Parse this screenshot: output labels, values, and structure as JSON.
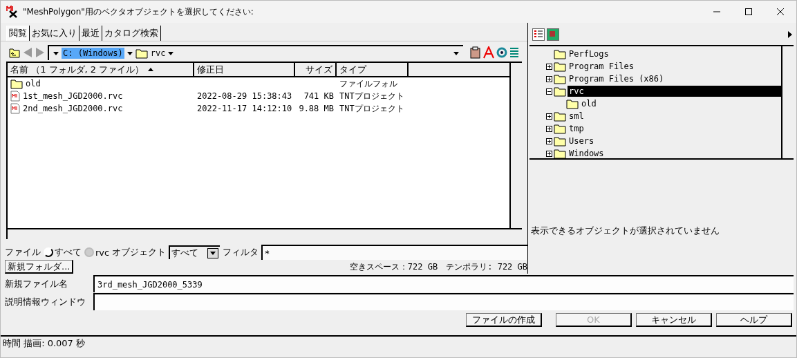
{
  "window": {
    "title": "\"MeshPolygon\"用のベクタオブジェクトを選択してください:"
  },
  "tabs": [
    {
      "label": "閲覧",
      "selected": true
    },
    {
      "label": "お気に入り",
      "selected": false
    },
    {
      "label": "最近",
      "selected": false
    },
    {
      "label": "カタログ検索",
      "selected": false
    }
  ],
  "path_bar": {
    "drive": "C: (Windows)",
    "folder": "rvc"
  },
  "file_list": {
    "columns": [
      "名前 （1 フォルダ, 2 ファイル）",
      "修正日",
      "サイズ",
      "タイプ"
    ],
    "rows": [
      {
        "kind": "folder",
        "name": "old",
        "modified": "",
        "size": "",
        "type": "ファイルフォル"
      },
      {
        "kind": "file",
        "name": "1st_mesh_JGD2000.rvc",
        "modified": "2022-08-29 15:38:43",
        "size": "741 KB",
        "type": "TNTプロジェクト"
      },
      {
        "kind": "file",
        "name": "2nd_mesh_JGD2000.rvc",
        "modified": "2022-11-17 14:12:10",
        "size": "9.88 MB",
        "type": "TNTプロジェクト"
      }
    ]
  },
  "filter_row": {
    "label": "ファイル",
    "radios": [
      {
        "label": "すべて",
        "selected": true
      },
      {
        "label": "rvc",
        "selected": false
      }
    ],
    "object_label": "オブジェクト",
    "object_value": "すべて",
    "filter_label": "フィルタ",
    "filter_value": "*"
  },
  "new_folder_button": "新規フォルダ...",
  "free_space": "空きスペース：722 GB",
  "temporary": "テンポラリ: 722 GB",
  "tree": [
    {
      "kind": "leaf",
      "name": "PerfLogs",
      "selected": false
    },
    {
      "kind": "branch",
      "name": "Program Files",
      "expanded": false,
      "selected": false
    },
    {
      "kind": "branch",
      "name": "Program Files (x86)",
      "expanded": false,
      "selected": false
    },
    {
      "kind": "branch",
      "name": "rvc",
      "expanded": true,
      "selected": true,
      "children": [
        {
          "kind": "leaf",
          "name": "old",
          "selected": false
        }
      ]
    },
    {
      "kind": "branch",
      "name": "sml",
      "expanded": false,
      "selected": false
    },
    {
      "kind": "branch",
      "name": "tmp",
      "expanded": false,
      "selected": false
    },
    {
      "kind": "branch",
      "name": "Users",
      "expanded": false,
      "selected": false
    },
    {
      "kind": "branch",
      "name": "Windows",
      "expanded": false,
      "selected": false
    }
  ],
  "object_message": "表示できるオブジェクトが選択されていません",
  "fields": [
    {
      "label": "新規ファイル名",
      "value": "3rd_mesh_JGD2000_5339"
    },
    {
      "label": "説明情報ウィンドウ"
    }
  ],
  "buttons": [
    {
      "label": "ファイルの作成",
      "disabled": false
    },
    {
      "label": "OK",
      "disabled": true
    },
    {
      "label": "キャンセル",
      "disabled": false
    },
    {
      "label": "ヘルプ",
      "disabled": false
    }
  ],
  "status_bar": "時間 描画: 0.007 秒"
}
